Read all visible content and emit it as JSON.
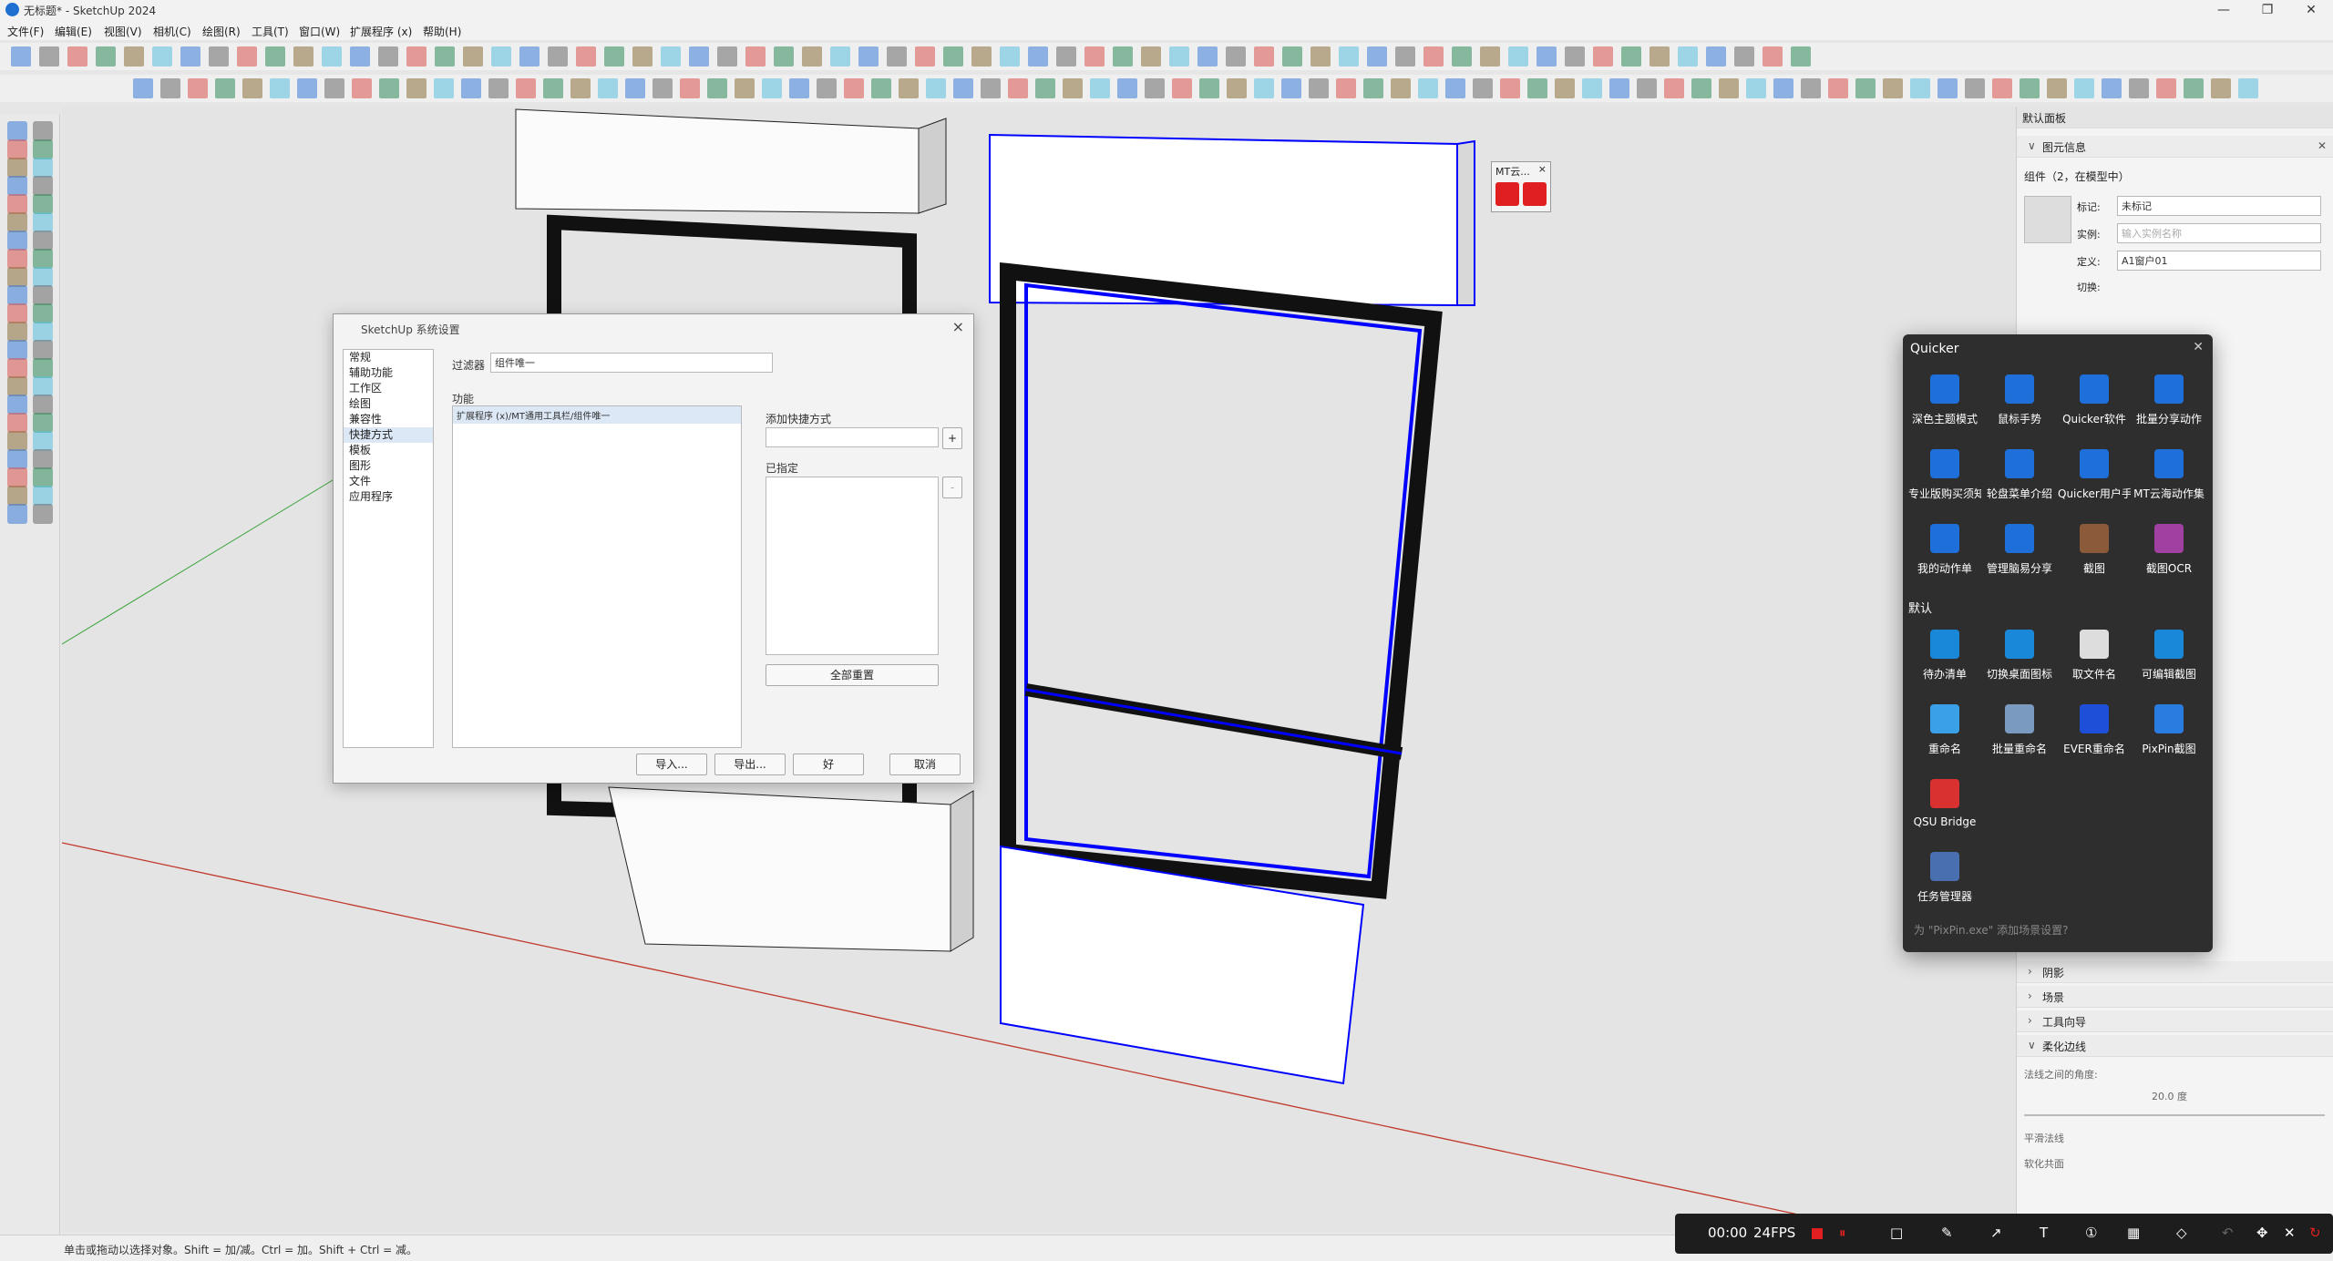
{
  "app": {
    "title": "无标题* - SketchUp 2024"
  },
  "menu": [
    "文件(F)",
    "编辑(E)",
    "视图(V)",
    "相机(C)",
    "绘图(R)",
    "工具(T)",
    "窗口(W)",
    "扩展程序 (x)",
    "帮助(H)"
  ],
  "status": {
    "hint": "单击或拖动以选择对象。Shift = 加/减。Ctrl = 加。Shift + Ctrl = 减。"
  },
  "mt_popup": {
    "label": "MT云..."
  },
  "panel": {
    "tray_title": "默认面板",
    "entity_info": "图元信息",
    "component_header": "组件（2，在模型中）",
    "tag_label": "标记:",
    "tag_value": "未标记",
    "instance_label": "实例:",
    "instance_placeholder": "输入实例名称",
    "definition_label": "定义:",
    "definition_value": "A1窗户01",
    "toggle_label": "切换:",
    "sections": [
      "阴影",
      "场景",
      "工具向导"
    ],
    "soften_title": "柔化边线",
    "normal_angle_label": "法线之间的角度:",
    "normal_angle_value": "20.0 度",
    "smooth_normals": "平滑法线",
    "soften_coplanar": "软化共面"
  },
  "dialog": {
    "title": "SketchUp 系统设置",
    "categories": [
      "常规",
      "辅助功能",
      "工作区",
      "绘图",
      "兼容性",
      "快捷方式",
      "模板",
      "图形",
      "文件",
      "应用程序"
    ],
    "selected_category": "快捷方式",
    "filter_label": "过滤器",
    "filter_value": "组件唯一",
    "function_label": "功能",
    "function_item": "扩展程序 (x)/MT通用工具栏/组件唯一",
    "add_shortcut_label": "添加快捷方式",
    "assigned_label": "已指定",
    "reset_all": "全部重置",
    "import": "导入...",
    "export": "导出...",
    "ok": "好",
    "cancel": "取消"
  },
  "quicker": {
    "title": "Quicker",
    "row1": [
      "深色主题模式",
      "鼠标手势",
      "Quicker软件",
      "批量分享动作"
    ],
    "row2": [
      "专业版购买须知",
      "轮盘菜单介绍",
      "Quicker用户手册",
      "MT云海动作集"
    ],
    "row3": [
      "我的动作单",
      "管理脑易分享",
      "截图",
      "截图OCR"
    ],
    "default_label": "默认",
    "row4": [
      "待办清单",
      "切换桌面图标",
      "取文件名",
      "可编辑截图"
    ],
    "row5": [
      "重命名",
      "批量重命名",
      "EVER重命名",
      "PixPin截图"
    ],
    "row6": [
      "QSU Bridge"
    ],
    "row7": [
      "任务管理器"
    ],
    "footer": "为 \"PixPin.exe\" 添加场景设置?"
  },
  "recorder": {
    "time": "00:00",
    "fps": "24FPS"
  },
  "colors": {
    "accent": "#1f6fd1",
    "selection_blue": "#0000ff",
    "record_red": "#e02020"
  }
}
